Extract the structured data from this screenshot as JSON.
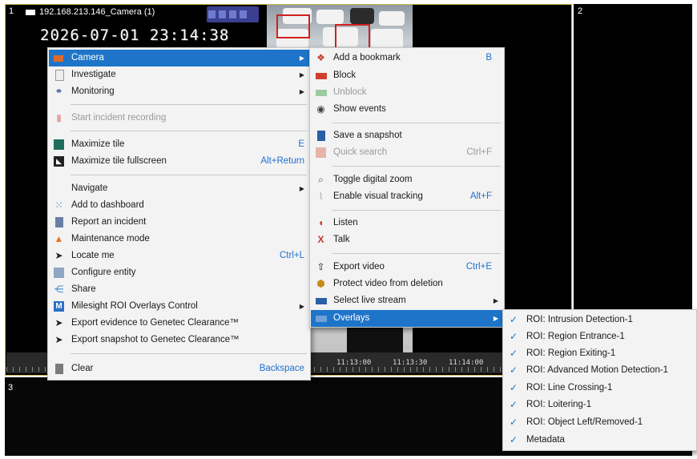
{
  "tiles": {
    "tile1_number": "1",
    "tile2_number": "2",
    "tile3_number": "3",
    "camera_name": "192.168.213.146_Camera",
    "camera_count": "(1)",
    "timestamp": "2026-07-01 23:14:38"
  },
  "timeline": {
    "labels": [
      "11:13:00",
      "11:13:30",
      "11:14:00"
    ]
  },
  "main_menu": {
    "items": [
      {
        "label": "Camera",
        "icon": "camera-icon"
      },
      {
        "label": "Investigate",
        "icon": "document-icon"
      },
      {
        "label": "Monitoring",
        "icon": "binoculars-icon"
      },
      {
        "label": "Start incident recording",
        "icon": "record-icon"
      },
      {
        "label": "Maximize tile",
        "shortcut": "E",
        "icon": "maximize-icon"
      },
      {
        "label": "Maximize tile fullscreen",
        "shortcut": "Alt+Return",
        "icon": "fullscreen-icon"
      },
      {
        "label": "Navigate"
      },
      {
        "label": "Add to dashboard",
        "icon": "dashboard-icon"
      },
      {
        "label": "Report an incident",
        "icon": "incident-icon"
      },
      {
        "label": "Maintenance mode",
        "icon": "cone-icon"
      },
      {
        "label": "Locate me",
        "shortcut": "Ctrl+L",
        "icon": "locate-icon"
      },
      {
        "label": "Configure entity",
        "icon": "configure-icon"
      },
      {
        "label": "Share",
        "icon": "share-icon"
      },
      {
        "label": "Milesight ROI Overlays Control",
        "icon": "milesight-icon"
      },
      {
        "label": "Export evidence to Genetec Clearance™",
        "icon": "send-icon"
      },
      {
        "label": "Export snapshot to Genetec Clearance™",
        "icon": "send-icon"
      },
      {
        "label": "Clear",
        "shortcut": "Backspace",
        "icon": "clear-icon"
      }
    ]
  },
  "camera_menu": {
    "items": [
      {
        "label": "Add a bookmark",
        "shortcut": "B"
      },
      {
        "label": "Block"
      },
      {
        "label": "Unblock"
      },
      {
        "label": "Show events"
      },
      {
        "label": "Save a snapshot"
      },
      {
        "label": "Quick search",
        "shortcut": "Ctrl+F"
      },
      {
        "label": "Toggle digital zoom"
      },
      {
        "label": "Enable visual tracking",
        "shortcut": "Alt+F"
      },
      {
        "label": "Listen"
      },
      {
        "label": "Talk"
      },
      {
        "label": "Export video",
        "shortcut": "Ctrl+E"
      },
      {
        "label": "Protect video from deletion"
      },
      {
        "label": "Select live stream"
      },
      {
        "label": "Overlays"
      }
    ]
  },
  "overlays_menu": {
    "items": [
      {
        "label": "ROI: Intrusion Detection-1",
        "checked": true
      },
      {
        "label": "ROI: Region Entrance-1",
        "checked": true
      },
      {
        "label": "ROI: Region Exiting-1",
        "checked": true
      },
      {
        "label": "ROI: Advanced Motion Detection-1",
        "checked": true
      },
      {
        "label": "ROI: Line Crossing-1",
        "checked": true
      },
      {
        "label": "ROI: Loitering-1",
        "checked": true
      },
      {
        "label": "ROI: Object Left/Removed-1",
        "checked": true
      },
      {
        "label": "Metadata",
        "checked": true
      }
    ]
  },
  "colors": {
    "highlight": "#1e74c8",
    "shortcut": "#1e6fd0",
    "tile_border": "#c9b44a"
  }
}
